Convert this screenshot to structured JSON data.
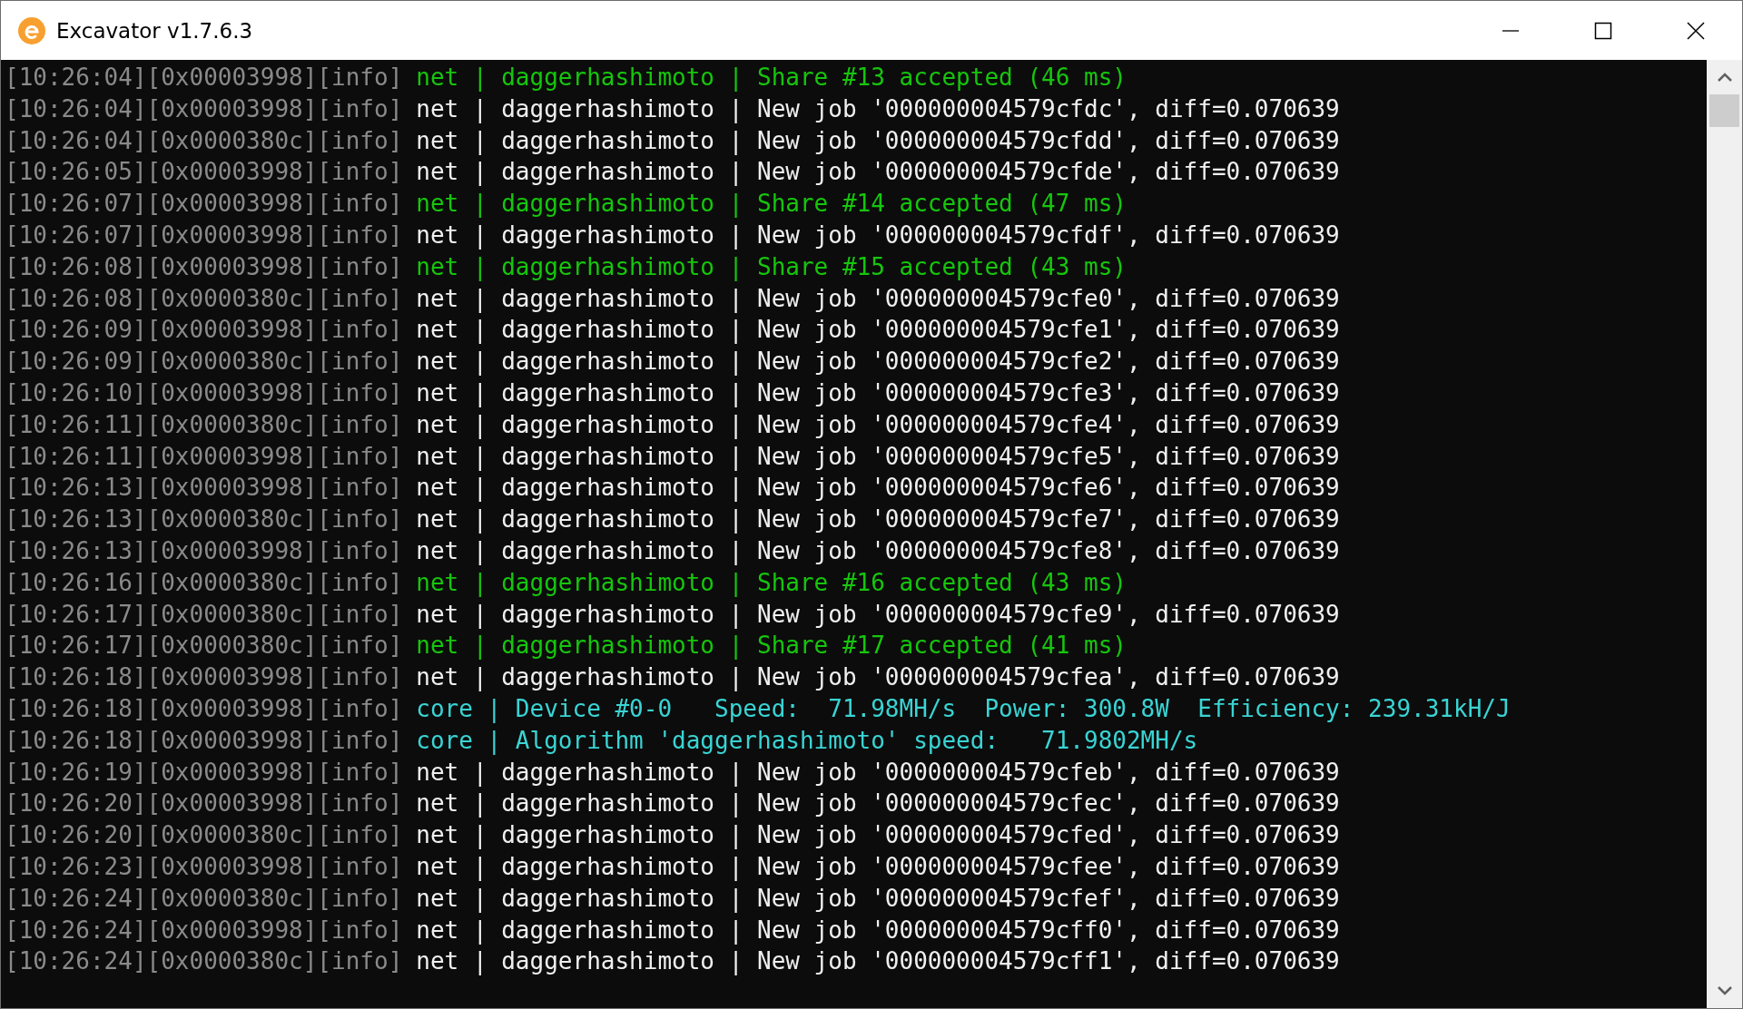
{
  "window": {
    "title": "Excavator v1.7.6.3"
  },
  "console": {
    "lines": [
      {
        "prefix": "[10:26:04][0x00003998][info]",
        "kind": "share",
        "message": "net | daggerhashimoto | Share #13 accepted (46 ms)"
      },
      {
        "prefix": "[10:26:04][0x00003998][info]",
        "kind": "job",
        "message": "net | daggerhashimoto | New job '000000004579cfdc', diff=0.070639"
      },
      {
        "prefix": "[10:26:04][0x0000380c][info]",
        "kind": "job",
        "message": "net | daggerhashimoto | New job '000000004579cfdd', diff=0.070639"
      },
      {
        "prefix": "[10:26:05][0x00003998][info]",
        "kind": "job",
        "message": "net | daggerhashimoto | New job '000000004579cfde', diff=0.070639"
      },
      {
        "prefix": "[10:26:07][0x00003998][info]",
        "kind": "share",
        "message": "net | daggerhashimoto | Share #14 accepted (47 ms)"
      },
      {
        "prefix": "[10:26:07][0x00003998][info]",
        "kind": "job",
        "message": "net | daggerhashimoto | New job '000000004579cfdf', diff=0.070639"
      },
      {
        "prefix": "[10:26:08][0x00003998][info]",
        "kind": "share",
        "message": "net | daggerhashimoto | Share #15 accepted (43 ms)"
      },
      {
        "prefix": "[10:26:08][0x0000380c][info]",
        "kind": "job",
        "message": "net | daggerhashimoto | New job '000000004579cfe0', diff=0.070639"
      },
      {
        "prefix": "[10:26:09][0x00003998][info]",
        "kind": "job",
        "message": "net | daggerhashimoto | New job '000000004579cfe1', diff=0.070639"
      },
      {
        "prefix": "[10:26:09][0x0000380c][info]",
        "kind": "job",
        "message": "net | daggerhashimoto | New job '000000004579cfe2', diff=0.070639"
      },
      {
        "prefix": "[10:26:10][0x00003998][info]",
        "kind": "job",
        "message": "net | daggerhashimoto | New job '000000004579cfe3', diff=0.070639"
      },
      {
        "prefix": "[10:26:11][0x0000380c][info]",
        "kind": "job",
        "message": "net | daggerhashimoto | New job '000000004579cfe4', diff=0.070639"
      },
      {
        "prefix": "[10:26:11][0x00003998][info]",
        "kind": "job",
        "message": "net | daggerhashimoto | New job '000000004579cfe5', diff=0.070639"
      },
      {
        "prefix": "[10:26:13][0x00003998][info]",
        "kind": "job",
        "message": "net | daggerhashimoto | New job '000000004579cfe6', diff=0.070639"
      },
      {
        "prefix": "[10:26:13][0x0000380c][info]",
        "kind": "job",
        "message": "net | daggerhashimoto | New job '000000004579cfe7', diff=0.070639"
      },
      {
        "prefix": "[10:26:13][0x00003998][info]",
        "kind": "job",
        "message": "net | daggerhashimoto | New job '000000004579cfe8', diff=0.070639"
      },
      {
        "prefix": "[10:26:16][0x0000380c][info]",
        "kind": "share",
        "message": "net | daggerhashimoto | Share #16 accepted (43 ms)"
      },
      {
        "prefix": "[10:26:17][0x0000380c][info]",
        "kind": "job",
        "message": "net | daggerhashimoto | New job '000000004579cfe9', diff=0.070639"
      },
      {
        "prefix": "[10:26:17][0x0000380c][info]",
        "kind": "share",
        "message": "net | daggerhashimoto | Share #17 accepted (41 ms)"
      },
      {
        "prefix": "[10:26:18][0x00003998][info]",
        "kind": "job",
        "message": "net | daggerhashimoto | New job '000000004579cfea', diff=0.070639"
      },
      {
        "prefix": "[10:26:18][0x00003998][info]",
        "kind": "core",
        "message": "core | Device #0-0   Speed:  71.98MH/s  Power: 300.8W  Efficiency: 239.31kH/J"
      },
      {
        "prefix": "[10:26:18][0x00003998][info]",
        "kind": "core",
        "message": "core | Algorithm 'daggerhashimoto' speed:   71.9802MH/s"
      },
      {
        "prefix": "[10:26:19][0x00003998][info]",
        "kind": "job",
        "message": "net | daggerhashimoto | New job '000000004579cfeb', diff=0.070639"
      },
      {
        "prefix": "[10:26:20][0x00003998][info]",
        "kind": "job",
        "message": "net | daggerhashimoto | New job '000000004579cfec', diff=0.070639"
      },
      {
        "prefix": "[10:26:20][0x0000380c][info]",
        "kind": "job",
        "message": "net | daggerhashimoto | New job '000000004579cfed', diff=0.070639"
      },
      {
        "prefix": "[10:26:23][0x00003998][info]",
        "kind": "job",
        "message": "net | daggerhashimoto | New job '000000004579cfee', diff=0.070639"
      },
      {
        "prefix": "[10:26:24][0x0000380c][info]",
        "kind": "job",
        "message": "net | daggerhashimoto | New job '000000004579cfef', diff=0.070639"
      },
      {
        "prefix": "[10:26:24][0x00003998][info]",
        "kind": "job",
        "message": "net | daggerhashimoto | New job '000000004579cff0', diff=0.070639"
      },
      {
        "prefix": "[10:26:24][0x0000380c][info]",
        "kind": "job",
        "message": "net | daggerhashimoto | New job '000000004579cff1', diff=0.070639"
      }
    ]
  }
}
